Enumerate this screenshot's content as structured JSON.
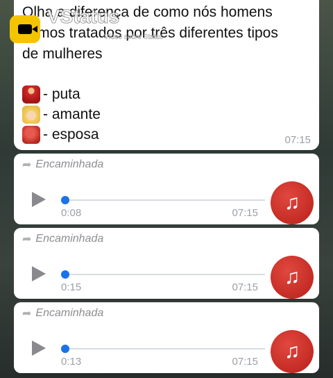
{
  "watermark": {
    "title": "VStatus",
    "subtitle": "Vídeo sobre Status"
  },
  "message": {
    "lines": [
      "Olha a diferença de como nós homens",
      "somos tratados por três diferentes tipos",
      "de mulheres"
    ],
    "items": [
      {
        "icon": "dancer-emoji",
        "text": "- puta"
      },
      {
        "icon": "blonde-woman-emoji",
        "text": "- amante"
      },
      {
        "icon": "red-ghost-emoji",
        "text": "- esposa"
      }
    ],
    "time": "07:15"
  },
  "audios": [
    {
      "forwarded": "Encaminhada",
      "duration": "0:08",
      "time": "07:15"
    },
    {
      "forwarded": "Encaminhada",
      "duration": "0:15",
      "time": "07:15"
    },
    {
      "forwarded": "Encaminhada",
      "duration": "0:13",
      "time": "07:15"
    }
  ],
  "colors": {
    "accent": "#1a73e8",
    "music_button": "#d32f2f",
    "bubble": "#ffffff"
  }
}
